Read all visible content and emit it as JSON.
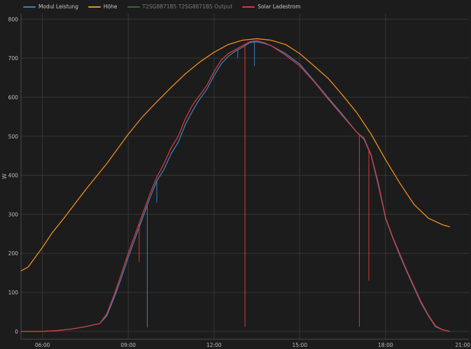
{
  "chart_data": {
    "type": "line",
    "ylabel": "W",
    "ylim": [
      -20,
      815
    ],
    "xlim": [
      "05:15",
      "20:55"
    ],
    "x_ticks": [
      "06:00",
      "09:00",
      "12:00",
      "15:00",
      "18:00",
      "21:00"
    ],
    "y_ticks": [
      0,
      100,
      200,
      300,
      400,
      500,
      600,
      700,
      800
    ],
    "grid": true,
    "legend_position": "top-left",
    "series": [
      {
        "name": "Modul Leistung",
        "color": "#3d7fc0",
        "visible": true,
        "points": [
          [
            "05:15",
            0
          ],
          [
            "06:00",
            0
          ],
          [
            "06:30",
            2
          ],
          [
            "07:00",
            6
          ],
          [
            "07:30",
            12
          ],
          [
            "08:00",
            20
          ],
          [
            "08:15",
            40
          ],
          [
            "08:30",
            85
          ],
          [
            "08:45",
            135
          ],
          [
            "09:00",
            190
          ],
          [
            "09:15",
            240
          ],
          [
            "09:30",
            290
          ],
          [
            "09:45",
            340
          ],
          [
            "10:00",
            385
          ],
          [
            "10:15",
            415
          ],
          [
            "10:30",
            455
          ],
          [
            "10:45",
            485
          ],
          [
            "11:00",
            530
          ],
          [
            "11:15",
            565
          ],
          [
            "11:30",
            595
          ],
          [
            "11:45",
            620
          ],
          [
            "12:00",
            655
          ],
          [
            "12:15",
            685
          ],
          [
            "12:30",
            705
          ],
          [
            "12:45",
            718
          ],
          [
            "13:00",
            728
          ],
          [
            "13:15",
            740
          ],
          [
            "13:30",
            742
          ],
          [
            "13:45",
            738
          ],
          [
            "14:00",
            732
          ],
          [
            "14:30",
            712
          ],
          [
            "15:00",
            685
          ],
          [
            "15:30",
            642
          ],
          [
            "16:00",
            598
          ],
          [
            "16:30",
            555
          ],
          [
            "17:00",
            510
          ],
          [
            "17:15",
            492
          ],
          [
            "17:30",
            450
          ],
          [
            "17:45",
            375
          ],
          [
            "18:00",
            290
          ],
          [
            "18:15",
            240
          ],
          [
            "18:30",
            195
          ],
          [
            "18:45",
            152
          ],
          [
            "19:00",
            112
          ],
          [
            "19:15",
            72
          ],
          [
            "19:30",
            40
          ],
          [
            "19:45",
            12
          ],
          [
            "20:00",
            4
          ],
          [
            "20:15",
            0
          ]
        ],
        "spikes": [
          [
            "09:40",
            10
          ],
          [
            "10:00",
            330
          ],
          [
            "12:50",
            700
          ],
          [
            "13:25",
            680
          ]
        ]
      },
      {
        "name": "Höhe",
        "color": "#f08c20",
        "visible": true,
        "points": [
          [
            "05:15",
            155
          ],
          [
            "05:30",
            165
          ],
          [
            "06:00",
            215
          ],
          [
            "06:20",
            252
          ],
          [
            "06:45",
            290
          ],
          [
            "07:30",
            362
          ],
          [
            "08:15",
            430
          ],
          [
            "09:00",
            505
          ],
          [
            "09:30",
            550
          ],
          [
            "10:00",
            588
          ],
          [
            "10:30",
            625
          ],
          [
            "11:00",
            660
          ],
          [
            "11:30",
            690
          ],
          [
            "12:00",
            715
          ],
          [
            "12:30",
            735
          ],
          [
            "13:00",
            746
          ],
          [
            "13:30",
            750
          ],
          [
            "14:00",
            746
          ],
          [
            "14:30",
            735
          ],
          [
            "15:00",
            712
          ],
          [
            "15:30",
            680
          ],
          [
            "16:00",
            648
          ],
          [
            "16:30",
            605
          ],
          [
            "17:00",
            560
          ],
          [
            "17:30",
            505
          ],
          [
            "18:00",
            440
          ],
          [
            "18:30",
            380
          ],
          [
            "19:00",
            325
          ],
          [
            "19:30",
            290
          ],
          [
            "20:00",
            273
          ],
          [
            "20:15",
            268
          ]
        ]
      },
      {
        "name": "T2SG8871B5 T2SG8871B5 Output",
        "color": "#2f6b3f",
        "visible": false,
        "points": []
      },
      {
        "name": "Solar Ladestrom",
        "color": "#d83838",
        "visible": true,
        "points": [
          [
            "05:15",
            0
          ],
          [
            "06:00",
            0
          ],
          [
            "06:30",
            2
          ],
          [
            "07:00",
            6
          ],
          [
            "07:30",
            12
          ],
          [
            "08:00",
            20
          ],
          [
            "08:15",
            45
          ],
          [
            "08:30",
            92
          ],
          [
            "08:45",
            145
          ],
          [
            "09:00",
            200
          ],
          [
            "09:15",
            250
          ],
          [
            "09:30",
            300
          ],
          [
            "09:45",
            350
          ],
          [
            "10:00",
            395
          ],
          [
            "10:15",
            430
          ],
          [
            "10:30",
            470
          ],
          [
            "10:45",
            500
          ],
          [
            "11:00",
            545
          ],
          [
            "11:15",
            580
          ],
          [
            "11:30",
            605
          ],
          [
            "11:45",
            630
          ],
          [
            "12:00",
            665
          ],
          [
            "12:15",
            695
          ],
          [
            "12:30",
            712
          ],
          [
            "12:45",
            722
          ],
          [
            "13:00",
            732
          ],
          [
            "13:15",
            742
          ],
          [
            "13:30",
            745
          ],
          [
            "13:45",
            740
          ],
          [
            "14:00",
            732
          ],
          [
            "14:30",
            708
          ],
          [
            "15:00",
            680
          ],
          [
            "15:30",
            640
          ],
          [
            "16:00",
            595
          ],
          [
            "16:30",
            552
          ],
          [
            "17:00",
            510
          ],
          [
            "17:15",
            495
          ],
          [
            "17:30",
            452
          ],
          [
            "17:45",
            380
          ],
          [
            "18:00",
            292
          ],
          [
            "18:15",
            242
          ],
          [
            "18:30",
            198
          ],
          [
            "18:45",
            155
          ],
          [
            "19:00",
            115
          ],
          [
            "19:15",
            75
          ],
          [
            "19:30",
            42
          ],
          [
            "19:45",
            14
          ],
          [
            "20:00",
            4
          ],
          [
            "20:15",
            0
          ]
        ],
        "spikes": [
          [
            "09:23",
            178
          ],
          [
            "13:05",
            12
          ],
          [
            "17:05",
            12
          ],
          [
            "17:25",
            130
          ],
          [
            "19:45",
            10
          ]
        ]
      }
    ]
  }
}
